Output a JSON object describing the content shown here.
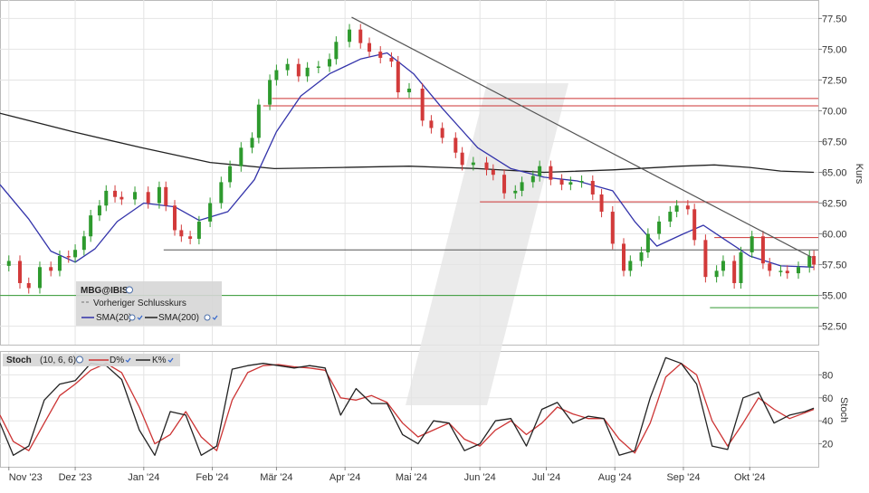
{
  "chart_data": [
    {
      "type": "candlestick",
      "symbol": "MBG@IBIS",
      "ylabel": "Kurs",
      "ylim": [
        51.0,
        79.0
      ],
      "y_ticks": [
        52.5,
        55.0,
        57.5,
        60.0,
        62.5,
        65.0,
        67.5,
        70.0,
        72.5,
        75.0,
        77.5
      ],
      "y_tick_labels": [
        "52.50",
        "55.00",
        "57.50",
        "60.00",
        "62.50",
        "65.00",
        "67.50",
        "70.00",
        "72.50",
        "75.00",
        "77.50"
      ],
      "x_range": [
        "2023-10-28",
        "2024-11-01"
      ],
      "x_ticks": [
        "2023-11-01",
        "2023-12-01",
        "2024-01-01",
        "2024-02-01",
        "2024-03-01",
        "2024-04-01",
        "2024-05-01",
        "2024-06-01",
        "2024-07-01",
        "2024-08-01",
        "2024-09-01",
        "2024-10-01"
      ],
      "x_tick_labels": [
        "Nov '23",
        "Dez '23",
        "Jan '24",
        "Feb '24",
        "Mär '24",
        "Apr '24",
        "Mai '24",
        "Jun '24",
        "Jul '24",
        "Aug '24",
        "Sep '24",
        "Okt '24"
      ],
      "grid": true,
      "legend": {
        "title": "MBG@IBIS",
        "items": [
          {
            "name": "Vorheriger Schlusskurs",
            "color": "#888888"
          },
          {
            "name": "SMA(20)",
            "color": "#3333aa"
          },
          {
            "name": "SMA(200)",
            "color": "#222222"
          }
        ],
        "placement": "bottom-left"
      },
      "close_series": [
        [
          "2023-11-01",
          57.8
        ],
        [
          "2023-11-06",
          56.0
        ],
        [
          "2023-11-10",
          55.6
        ],
        [
          "2023-11-15",
          57.3
        ],
        [
          "2023-11-20",
          57.0
        ],
        [
          "2023-11-24",
          58.2
        ],
        [
          "2023-11-28",
          58.1
        ],
        [
          "2023-12-01",
          58.7
        ],
        [
          "2023-12-05",
          59.8
        ],
        [
          "2023-12-08",
          61.5
        ],
        [
          "2023-12-12",
          62.3
        ],
        [
          "2023-12-15",
          63.5
        ],
        [
          "2023-12-19",
          63.0
        ],
        [
          "2023-12-22",
          62.8
        ],
        [
          "2023-12-28",
          63.4
        ],
        [
          "2024-01-03",
          62.5
        ],
        [
          "2024-01-08",
          63.8
        ],
        [
          "2024-01-11",
          62.3
        ],
        [
          "2024-01-15",
          60.3
        ],
        [
          "2024-01-18",
          59.8
        ],
        [
          "2024-01-22",
          59.6
        ],
        [
          "2024-01-26",
          61.0
        ],
        [
          "2024-01-31",
          62.5
        ],
        [
          "2024-02-05",
          64.2
        ],
        [
          "2024-02-09",
          65.5
        ],
        [
          "2024-02-14",
          67.0
        ],
        [
          "2024-02-19",
          67.8
        ],
        [
          "2024-02-22",
          70.5
        ],
        [
          "2024-02-27",
          72.5
        ],
        [
          "2024-03-01",
          73.3
        ],
        [
          "2024-03-06",
          73.8
        ],
        [
          "2024-03-11",
          72.8
        ],
        [
          "2024-03-15",
          73.5
        ],
        [
          "2024-03-20",
          73.6
        ],
        [
          "2024-03-25",
          74.2
        ],
        [
          "2024-03-28",
          75.6
        ],
        [
          "2024-04-03",
          76.6
        ],
        [
          "2024-04-08",
          75.5
        ],
        [
          "2024-04-12",
          74.8
        ],
        [
          "2024-04-17",
          74.3
        ],
        [
          "2024-04-22",
          74.0
        ],
        [
          "2024-04-25",
          71.5
        ],
        [
          "2024-04-30",
          71.8
        ],
        [
          "2024-05-06",
          69.2
        ],
        [
          "2024-05-10",
          68.6
        ],
        [
          "2024-05-15",
          67.8
        ],
        [
          "2024-05-21",
          66.6
        ],
        [
          "2024-05-24",
          65.6
        ],
        [
          "2024-05-29",
          65.8
        ],
        [
          "2024-06-04",
          65.2
        ],
        [
          "2024-06-07",
          64.8
        ],
        [
          "2024-06-12",
          63.3
        ],
        [
          "2024-06-17",
          63.5
        ],
        [
          "2024-06-20",
          64.2
        ],
        [
          "2024-06-25",
          64.7
        ],
        [
          "2024-06-28",
          65.5
        ],
        [
          "2024-07-03",
          64.4
        ],
        [
          "2024-07-08",
          64.0
        ],
        [
          "2024-07-12",
          64.2
        ],
        [
          "2024-07-17",
          64.3
        ],
        [
          "2024-07-22",
          63.2
        ],
        [
          "2024-07-26",
          61.8
        ],
        [
          "2024-07-31",
          59.2
        ],
        [
          "2024-08-05",
          57.0
        ],
        [
          "2024-08-08",
          57.8
        ],
        [
          "2024-08-13",
          58.5
        ],
        [
          "2024-08-16",
          60.0
        ],
        [
          "2024-08-21",
          61.0
        ],
        [
          "2024-08-26",
          61.8
        ],
        [
          "2024-08-29",
          62.3
        ],
        [
          "2024-09-03",
          62.0
        ],
        [
          "2024-09-06",
          59.5
        ],
        [
          "2024-09-11",
          56.5
        ],
        [
          "2024-09-16",
          57.0
        ],
        [
          "2024-09-19",
          57.8
        ],
        [
          "2024-09-24",
          56.0
        ],
        [
          "2024-09-27",
          58.5
        ],
        [
          "2024-10-02",
          59.8
        ],
        [
          "2024-10-07",
          57.6
        ],
        [
          "2024-10-10",
          57.0
        ],
        [
          "2024-10-15",
          57.0
        ],
        [
          "2024-10-18",
          56.8
        ],
        [
          "2024-10-23",
          57.3
        ],
        [
          "2024-10-28",
          58.2
        ],
        [
          "2024-10-30",
          57.5
        ]
      ],
      "sma20": [
        [
          "2023-10-28",
          64.0
        ],
        [
          "2023-11-10",
          61.2
        ],
        [
          "2023-11-20",
          58.6
        ],
        [
          "2023-12-01",
          57.7
        ],
        [
          "2023-12-10",
          58.8
        ],
        [
          "2023-12-20",
          61.0
        ],
        [
          "2024-01-01",
          62.5
        ],
        [
          "2024-01-15",
          62.2
        ],
        [
          "2024-01-26",
          61.1
        ],
        [
          "2024-02-08",
          61.8
        ],
        [
          "2024-02-20",
          64.4
        ],
        [
          "2024-03-01",
          68.3
        ],
        [
          "2024-03-12",
          71.2
        ],
        [
          "2024-03-25",
          73.0
        ],
        [
          "2024-04-08",
          74.2
        ],
        [
          "2024-04-20",
          74.7
        ],
        [
          "2024-05-02",
          73.0
        ],
        [
          "2024-05-15",
          70.2
        ],
        [
          "2024-05-31",
          67.0
        ],
        [
          "2024-06-15",
          65.3
        ],
        [
          "2024-06-30",
          64.6
        ],
        [
          "2024-07-15",
          64.3
        ],
        [
          "2024-07-31",
          63.5
        ],
        [
          "2024-08-10",
          61.0
        ],
        [
          "2024-08-20",
          59.0
        ],
        [
          "2024-09-01",
          60.0
        ],
        [
          "2024-09-10",
          60.7
        ],
        [
          "2024-09-20",
          59.5
        ],
        [
          "2024-10-01",
          58.2
        ],
        [
          "2024-10-15",
          57.4
        ],
        [
          "2024-10-30",
          57.3
        ]
      ],
      "sma200": [
        [
          "2023-10-28",
          69.8
        ],
        [
          "2023-11-30",
          68.3
        ],
        [
          "2023-12-31",
          67.0
        ],
        [
          "2024-01-31",
          65.8
        ],
        [
          "2024-02-29",
          65.3
        ],
        [
          "2024-03-31",
          65.4
        ],
        [
          "2024-04-30",
          65.5
        ],
        [
          "2024-05-31",
          65.3
        ],
        [
          "2024-06-30",
          65.0
        ],
        [
          "2024-07-31",
          65.2
        ],
        [
          "2024-08-31",
          65.5
        ],
        [
          "2024-09-15",
          65.6
        ],
        [
          "2024-10-01",
          65.4
        ],
        [
          "2024-10-15",
          65.1
        ],
        [
          "2024-10-30",
          65.0
        ]
      ],
      "horizontal_lines": [
        {
          "y": 71.0,
          "x_from": "2024-02-28",
          "x_to": "2024-11-01",
          "color": "#cc3333"
        },
        {
          "y": 70.4,
          "x_from": "2024-02-24",
          "x_to": "2024-11-01",
          "color": "#cc3333"
        },
        {
          "y": 62.6,
          "x_from": "2024-06-01",
          "x_to": "2024-11-01",
          "color": "#cc3333"
        },
        {
          "y": 59.7,
          "x_from": "2024-09-15",
          "x_to": "2024-11-01",
          "color": "#cc3333"
        },
        {
          "y": 58.7,
          "x_from": "2024-01-10",
          "x_to": "2024-11-01",
          "color": "#555555"
        },
        {
          "y": 55.0,
          "x_from": "2023-10-28",
          "x_to": "2024-11-01",
          "color": "#339933"
        },
        {
          "y": 54.0,
          "x_from": "2024-09-13",
          "x_to": "2024-11-01",
          "color": "#339933"
        }
      ],
      "trendline": {
        "from": [
          "2024-04-04",
          77.6
        ],
        "to": [
          "2024-10-29",
          58.1
        ],
        "color": "#555555"
      }
    },
    {
      "type": "line",
      "title": "Stoch",
      "params": "(10, 6, 6)",
      "ylabel": "Stoch",
      "ylim": [
        0,
        100
      ],
      "y_ticks": [
        20,
        40,
        60,
        80
      ],
      "series_names": [
        "D%",
        "K%"
      ],
      "series": [
        {
          "name": "K%",
          "color": "#222222",
          "points": [
            [
              "2023-10-28",
              38
            ],
            [
              "2023-11-03",
              10
            ],
            [
              "2023-11-10",
              18
            ],
            [
              "2023-11-17",
              58
            ],
            [
              "2023-11-24",
              72
            ],
            [
              "2023-12-01",
              75
            ],
            [
              "2023-12-08",
              90
            ],
            [
              "2023-12-15",
              88
            ],
            [
              "2023-12-22",
              76
            ],
            [
              "2023-12-30",
              32
            ],
            [
              "2024-01-06",
              10
            ],
            [
              "2024-01-13",
              48
            ],
            [
              "2024-01-20",
              45
            ],
            [
              "2024-01-27",
              10
            ],
            [
              "2024-02-03",
              18
            ],
            [
              "2024-02-10",
              85
            ],
            [
              "2024-02-17",
              88
            ],
            [
              "2024-02-24",
              90
            ],
            [
              "2024-03-02",
              88
            ],
            [
              "2024-03-09",
              86
            ],
            [
              "2024-03-16",
              88
            ],
            [
              "2024-03-23",
              86
            ],
            [
              "2024-03-30",
              45
            ],
            [
              "2024-04-06",
              68
            ],
            [
              "2024-04-13",
              55
            ],
            [
              "2024-04-20",
              55
            ],
            [
              "2024-04-27",
              28
            ],
            [
              "2024-05-04",
              20
            ],
            [
              "2024-05-11",
              40
            ],
            [
              "2024-05-18",
              38
            ],
            [
              "2024-05-25",
              14
            ],
            [
              "2024-06-01",
              20
            ],
            [
              "2024-06-08",
              40
            ],
            [
              "2024-06-15",
              42
            ],
            [
              "2024-06-22",
              18
            ],
            [
              "2024-06-29",
              50
            ],
            [
              "2024-07-06",
              56
            ],
            [
              "2024-07-13",
              38
            ],
            [
              "2024-07-20",
              44
            ],
            [
              "2024-07-27",
              42
            ],
            [
              "2024-08-03",
              10
            ],
            [
              "2024-08-10",
              14
            ],
            [
              "2024-08-17",
              60
            ],
            [
              "2024-08-24",
              95
            ],
            [
              "2024-08-31",
              90
            ],
            [
              "2024-09-07",
              72
            ],
            [
              "2024-09-14",
              18
            ],
            [
              "2024-09-21",
              15
            ],
            [
              "2024-09-28",
              60
            ],
            [
              "2024-10-05",
              65
            ],
            [
              "2024-10-12",
              38
            ],
            [
              "2024-10-19",
              45
            ],
            [
              "2024-10-26",
              48
            ],
            [
              "2024-10-30",
              51
            ]
          ]
        },
        {
          "name": "D%",
          "color": "#cc3333",
          "points": [
            [
              "2023-10-28",
              45
            ],
            [
              "2023-11-03",
              22
            ],
            [
              "2023-11-10",
              14
            ],
            [
              "2023-11-17",
              38
            ],
            [
              "2023-11-24",
              62
            ],
            [
              "2023-12-01",
              72
            ],
            [
              "2023-12-08",
              84
            ],
            [
              "2023-12-15",
              90
            ],
            [
              "2023-12-22",
              82
            ],
            [
              "2023-12-30",
              52
            ],
            [
              "2024-01-06",
              20
            ],
            [
              "2024-01-13",
              28
            ],
            [
              "2024-01-20",
              48
            ],
            [
              "2024-01-27",
              26
            ],
            [
              "2024-02-03",
              14
            ],
            [
              "2024-02-10",
              58
            ],
            [
              "2024-02-17",
              82
            ],
            [
              "2024-02-24",
              88
            ],
            [
              "2024-03-02",
              89
            ],
            [
              "2024-03-09",
              87
            ],
            [
              "2024-03-16",
              86
            ],
            [
              "2024-03-23",
              84
            ],
            [
              "2024-03-30",
              60
            ],
            [
              "2024-04-06",
              58
            ],
            [
              "2024-04-13",
              62
            ],
            [
              "2024-04-20",
              56
            ],
            [
              "2024-04-27",
              38
            ],
            [
              "2024-05-04",
              26
            ],
            [
              "2024-05-11",
              32
            ],
            [
              "2024-05-18",
              38
            ],
            [
              "2024-05-25",
              24
            ],
            [
              "2024-06-01",
              18
            ],
            [
              "2024-06-08",
              32
            ],
            [
              "2024-06-15",
              40
            ],
            [
              "2024-06-22",
              28
            ],
            [
              "2024-06-29",
              38
            ],
            [
              "2024-07-06",
              52
            ],
            [
              "2024-07-13",
              46
            ],
            [
              "2024-07-20",
              42
            ],
            [
              "2024-07-27",
              42
            ],
            [
              "2024-08-03",
              24
            ],
            [
              "2024-08-10",
              12
            ],
            [
              "2024-08-17",
              38
            ],
            [
              "2024-08-24",
              78
            ],
            [
              "2024-08-31",
              90
            ],
            [
              "2024-09-07",
              80
            ],
            [
              "2024-09-14",
              40
            ],
            [
              "2024-09-21",
              18
            ],
            [
              "2024-09-28",
              38
            ],
            [
              "2024-10-05",
              60
            ],
            [
              "2024-10-12",
              50
            ],
            [
              "2024-10-19",
              42
            ],
            [
              "2024-10-26",
              47
            ],
            [
              "2024-10-30",
              50
            ]
          ]
        }
      ]
    }
  ]
}
